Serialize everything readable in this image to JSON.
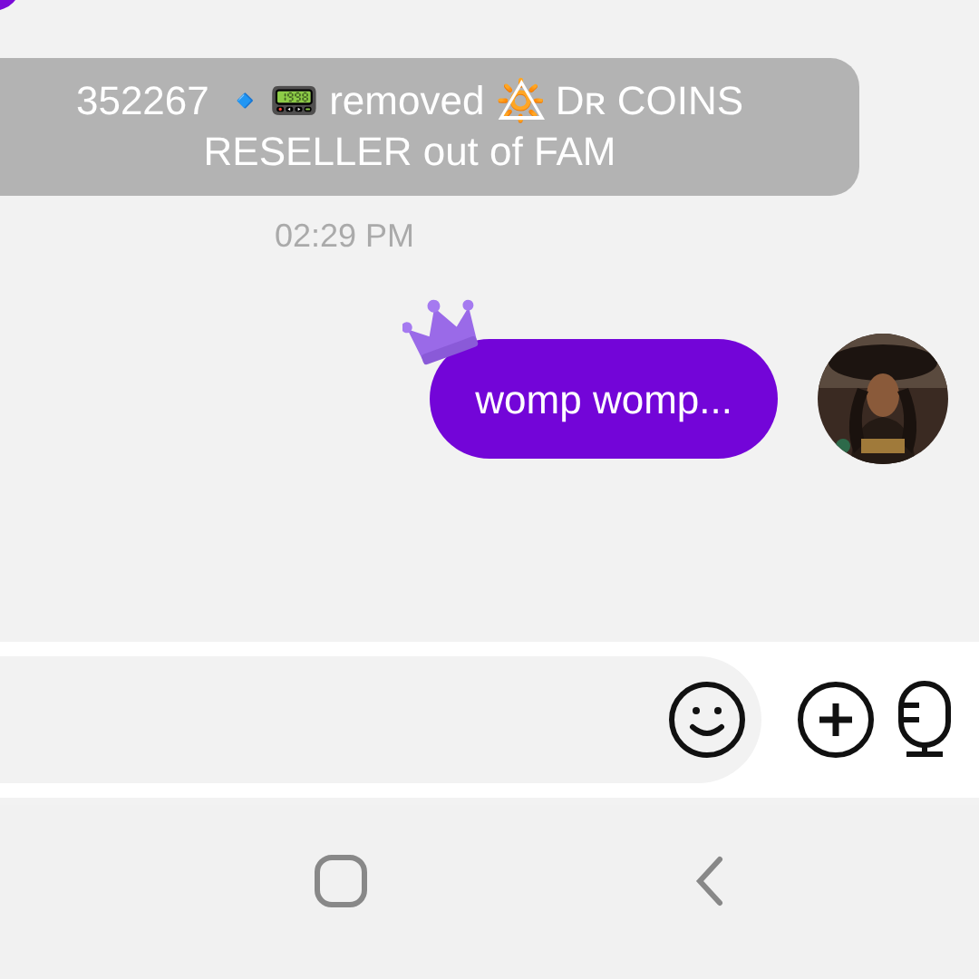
{
  "system_message": {
    "text": "352267 🔹📟 removed 🔆⃤ Dʀ COINS RESELLER out of FAM"
  },
  "timestamp": "02:29 PM",
  "messages": [
    {
      "text": "womp womp...",
      "outgoing": true
    }
  ]
}
